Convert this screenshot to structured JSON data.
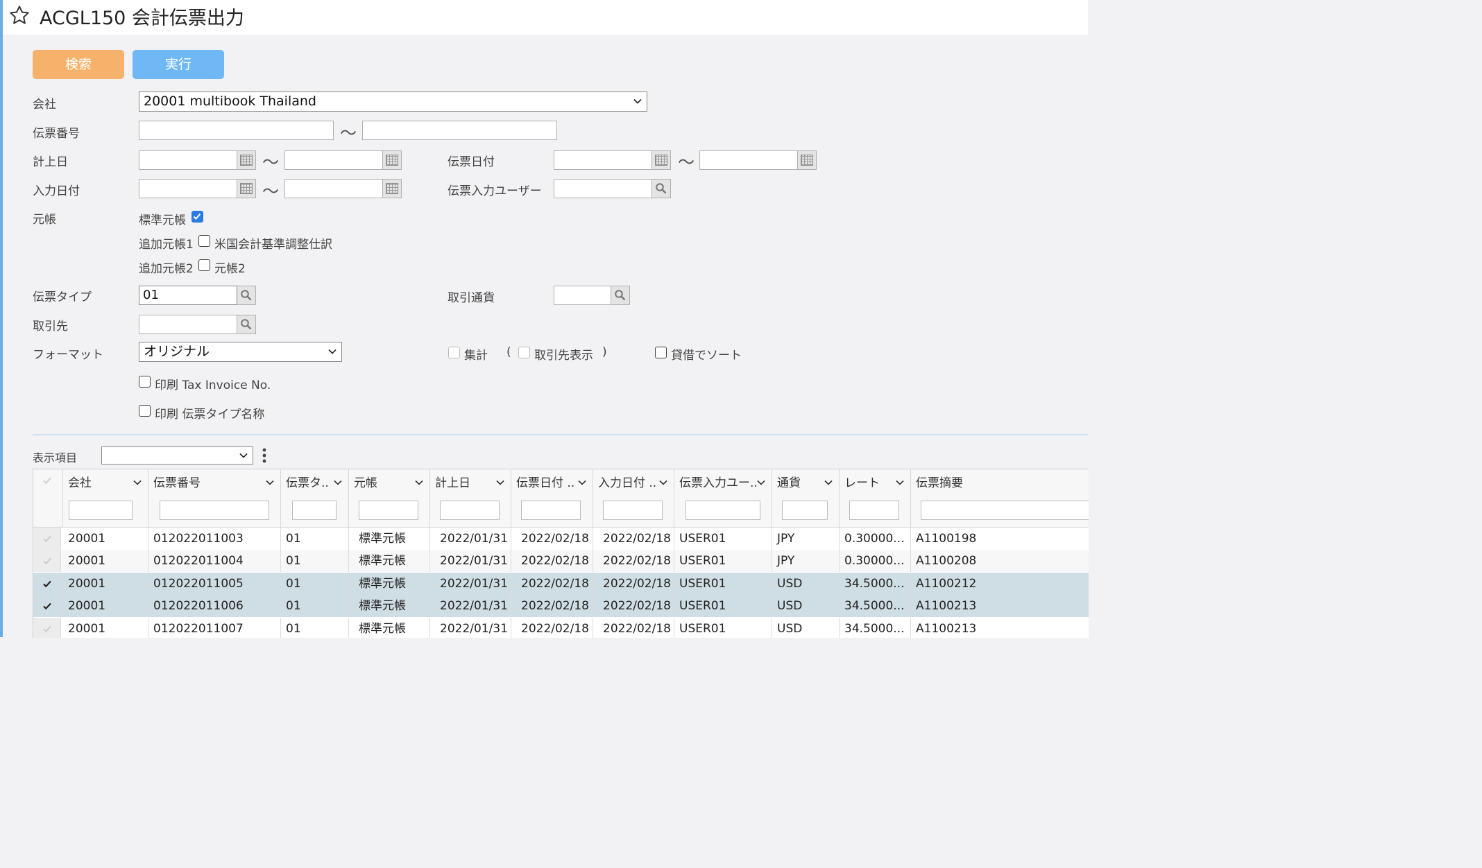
{
  "window": {
    "title": "ACGL150 会計伝票出力"
  },
  "toolbar": {
    "search_label": "検索",
    "run_label": "実行"
  },
  "form": {
    "company": {
      "label": "会社",
      "value": "20001 multibook Thailand"
    },
    "voucher_no": {
      "label": "伝票番号",
      "from": "",
      "to": ""
    },
    "posting_date": {
      "label": "計上日",
      "from": "",
      "to": ""
    },
    "voucher_date": {
      "label": "伝票日付",
      "from": "",
      "to": ""
    },
    "input_date": {
      "label": "入力日付",
      "from": "",
      "to": ""
    },
    "input_user": {
      "label": "伝票入力ユーザー",
      "value": ""
    },
    "ledger": {
      "label": "元帳",
      "standard_label": "標準元帳",
      "standard_checked": true,
      "add1_label": "追加元帳1",
      "add1_name": "米国会計基準調整仕訳",
      "add1_checked": false,
      "add2_label": "追加元帳2",
      "add2_name": "元帳2",
      "add2_checked": false
    },
    "voucher_type": {
      "label": "伝票タイプ",
      "value": "01"
    },
    "currency": {
      "label": "取引通貨",
      "value": ""
    },
    "partner": {
      "label": "取引先",
      "value": ""
    },
    "format": {
      "label": "フォーマット",
      "value": "オリジナル"
    },
    "summary_label": "集計",
    "paren_open": "(",
    "show_partner_label": "取引先表示",
    "paren_close": ")",
    "sort_label": "貸借でソート",
    "print_tax_label": "印刷 Tax Invoice No.",
    "print_type_label": "印刷 伝票タイプ名称"
  },
  "display": {
    "label": "表示項目",
    "value": ""
  },
  "table": {
    "columns": [
      "会社",
      "伝票番号",
      "伝票タ..",
      "元帳",
      "計上日",
      "伝票日付 ..",
      "入力日付 ..",
      "伝票入力ユー..",
      "通貨",
      "レート",
      "伝票摘要"
    ],
    "rows": [
      {
        "checked": false,
        "cells": [
          "20001",
          "012022011003",
          "01",
          "標準元帳",
          "2022/01/31",
          "2022/02/18",
          "2022/02/18",
          "USER01",
          "JPY",
          "0.30000...",
          "A1100198"
        ]
      },
      {
        "checked": false,
        "cells": [
          "20001",
          "012022011004",
          "01",
          "標準元帳",
          "2022/01/31",
          "2022/02/18",
          "2022/02/18",
          "USER01",
          "JPY",
          "0.30000...",
          "A1100208"
        ]
      },
      {
        "checked": true,
        "cells": [
          "20001",
          "012022011005",
          "01",
          "標準元帳",
          "2022/01/31",
          "2022/02/18",
          "2022/02/18",
          "USER01",
          "USD",
          "34.5000...",
          "A1100212"
        ]
      },
      {
        "checked": true,
        "cells": [
          "20001",
          "012022011006",
          "01",
          "標準元帳",
          "2022/01/31",
          "2022/02/18",
          "2022/02/18",
          "USER01",
          "USD",
          "34.5000...",
          "A1100213"
        ]
      },
      {
        "checked": false,
        "cells": [
          "20001",
          "012022011007",
          "01",
          "標準元帳",
          "2022/01/31",
          "2022/02/18",
          "2022/02/18",
          "USER01",
          "USD",
          "34.5000...",
          "A1100213"
        ]
      }
    ]
  },
  "colors": {
    "accent": "#6fb8f5",
    "search": "#f6b26b",
    "selected_row": "#cfdde4",
    "checkbox": "#2b7ce0"
  }
}
